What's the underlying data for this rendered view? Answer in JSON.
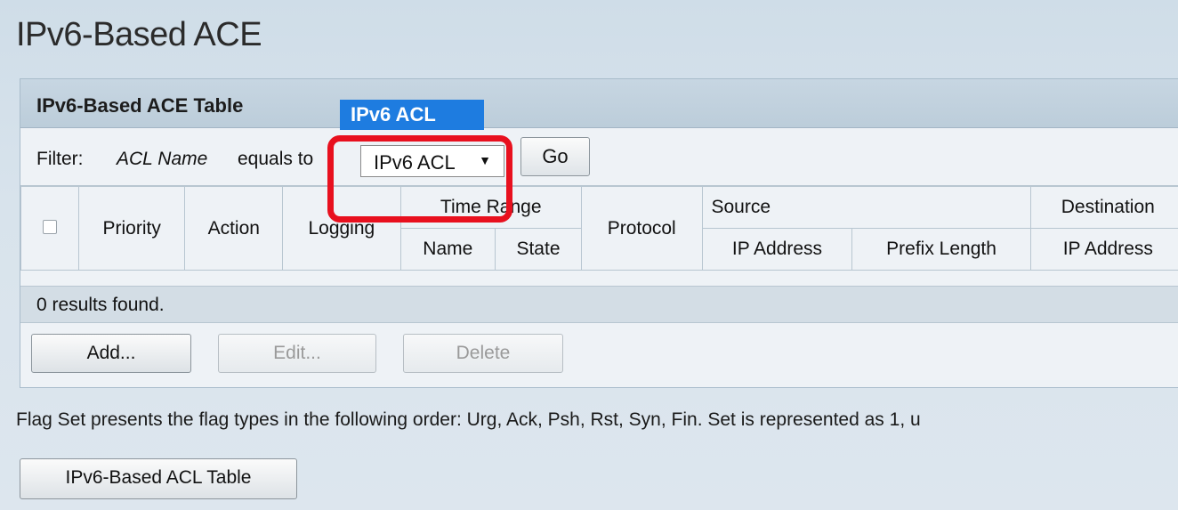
{
  "page": {
    "title": "IPv6-Based ACE"
  },
  "panel": {
    "header": "IPv6-Based ACE Table",
    "filter": {
      "label": "Filter:",
      "field": "ACL Name",
      "operator": "equals to",
      "selected_value": "IPv6 ACL",
      "options": [
        "IPv6 ACL"
      ],
      "go_label": "Go"
    },
    "table": {
      "columns": {
        "priority": "Priority",
        "action": "Action",
        "logging": "Logging",
        "time_range": "Time Range",
        "time_range_name": "Name",
        "time_range_state": "State",
        "protocol": "Protocol",
        "source": "Source",
        "source_ip": "IP Address",
        "source_prefix": "Prefix Length",
        "destination": "Destination",
        "destination_ip": "IP Address"
      },
      "results_text": "0 results found."
    },
    "buttons": {
      "add": "Add...",
      "edit": "Edit...",
      "delete": "Delete"
    }
  },
  "note": "Flag Set presents the flag types in the following order: Urg, Ack, Psh, Rst, Syn, Fin. Set is represented as 1, u",
  "acl_table_button": "IPv6-Based ACL Table",
  "colors": {
    "highlight": "#e8101e",
    "dropdown_selected": "#1e7ce0"
  },
  "icons": {
    "select_arrow": "caret-down-icon"
  }
}
